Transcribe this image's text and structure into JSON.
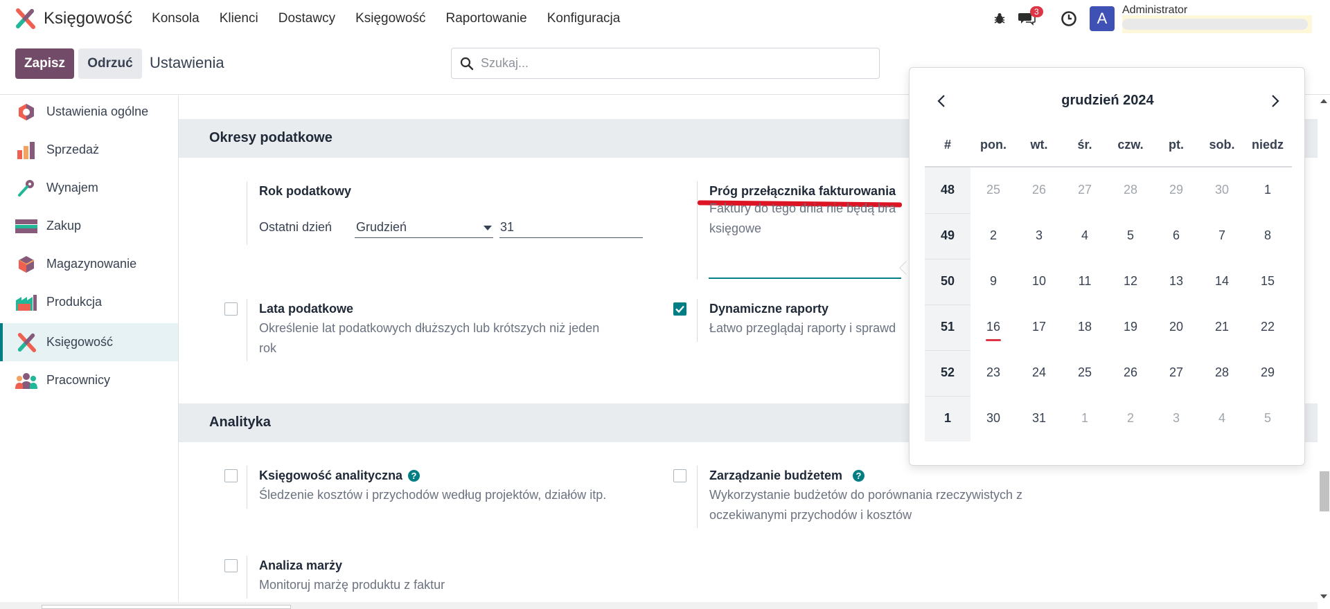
{
  "app": {
    "brand": "Księgowość"
  },
  "menu": [
    "Konsola",
    "Klienci",
    "Dostawcy",
    "Księgowość",
    "Raportowanie",
    "Konfiguracja"
  ],
  "systray": {
    "messages_count": "3",
    "user_initial": "A",
    "user_name": "Administrator"
  },
  "control": {
    "save": "Zapisz",
    "discard": "Odrzuć",
    "title": "Ustawienia",
    "search_placeholder": "Szukaj..."
  },
  "sidebar": [
    {
      "label": "Ustawienia ogólne",
      "icon": "settings-app-icon"
    },
    {
      "label": "Sprzedaż",
      "icon": "sales-app-icon"
    },
    {
      "label": "Wynajem",
      "icon": "rental-app-icon"
    },
    {
      "label": "Zakup",
      "icon": "purchase-app-icon"
    },
    {
      "label": "Magazynowanie",
      "icon": "inventory-app-icon"
    },
    {
      "label": "Produkcja",
      "icon": "manufacturing-app-icon"
    },
    {
      "label": "Księgowość",
      "icon": "accounting-app-icon",
      "active": true
    },
    {
      "label": "Pracownicy",
      "icon": "employees-app-icon"
    }
  ],
  "sections": {
    "tax": {
      "title": "Okresy podatkowe",
      "fiscal_year": {
        "label": "Rok podatkowy",
        "last_day_label": "Ostatni dzień",
        "month": "Grudzień",
        "day": "31"
      },
      "invoicing_switch": {
        "label": "Próg przełącznika fakturowania",
        "desc": "Faktury do tego dnia nie będą bra",
        "desc2": "księgowe"
      },
      "tax_years": {
        "label": "Lata podatkowe",
        "desc": "Określenie lat podatkowych dłuższych lub krótszych niż jeden",
        "desc2": "rok",
        "checked": false
      },
      "dynamic_reports": {
        "label": "Dynamiczne raporty",
        "desc": "Łatwo przeglądaj raporty i sprawd",
        "checked": true
      }
    },
    "analytics": {
      "title": "Analityka",
      "analytic_accounting": {
        "label": "Księgowość analityczna",
        "desc": "Śledzenie kosztów i przychodów według projektów, działów itp.",
        "checked": false
      },
      "budget": {
        "label": "Zarządzanie budżetem",
        "desc": "Wykorzystanie budżetów do porównania rzeczywistych z",
        "desc2": "oczekiwanymi przychodów i kosztów",
        "checked": false
      },
      "margin": {
        "label": "Analiza marży",
        "desc": "Monitoruj marżę produktu z faktur",
        "checked": false
      }
    }
  },
  "datepicker": {
    "title": "grudzień 2024",
    "headers": [
      "#",
      "pon.",
      "wt.",
      "śr.",
      "czw.",
      "pt.",
      "sob.",
      "niedz"
    ],
    "weeks": [
      {
        "num": "48",
        "days": [
          [
            "25",
            true
          ],
          [
            "26",
            true
          ],
          [
            "27",
            true
          ],
          [
            "28",
            true
          ],
          [
            "29",
            true
          ],
          [
            "30",
            true
          ],
          [
            "1",
            false
          ]
        ]
      },
      {
        "num": "49",
        "days": [
          [
            "2",
            false
          ],
          [
            "3",
            false
          ],
          [
            "4",
            false
          ],
          [
            "5",
            false
          ],
          [
            "6",
            false
          ],
          [
            "7",
            false
          ],
          [
            "8",
            false
          ]
        ]
      },
      {
        "num": "50",
        "days": [
          [
            "9",
            false
          ],
          [
            "10",
            false
          ],
          [
            "11",
            false
          ],
          [
            "12",
            false
          ],
          [
            "13",
            false
          ],
          [
            "14",
            false
          ],
          [
            "15",
            false
          ]
        ]
      },
      {
        "num": "51",
        "days": [
          [
            "16",
            false
          ],
          [
            "17",
            false
          ],
          [
            "18",
            false
          ],
          [
            "19",
            false
          ],
          [
            "20",
            false
          ],
          [
            "21",
            false
          ],
          [
            "22",
            false
          ]
        ]
      },
      {
        "num": "52",
        "days": [
          [
            "23",
            false
          ],
          [
            "24",
            false
          ],
          [
            "25",
            false
          ],
          [
            "26",
            false
          ],
          [
            "27",
            false
          ],
          [
            "28",
            false
          ],
          [
            "29",
            false
          ]
        ]
      },
      {
        "num": "1",
        "days": [
          [
            "30",
            false
          ],
          [
            "31",
            false
          ],
          [
            "1",
            true
          ],
          [
            "2",
            true
          ],
          [
            "3",
            true
          ],
          [
            "4",
            true
          ],
          [
            "5",
            true
          ]
        ]
      }
    ],
    "today": "16"
  },
  "colors": {
    "brand": "#714b67",
    "accent": "#017e84",
    "annotation": "#dc1424"
  }
}
